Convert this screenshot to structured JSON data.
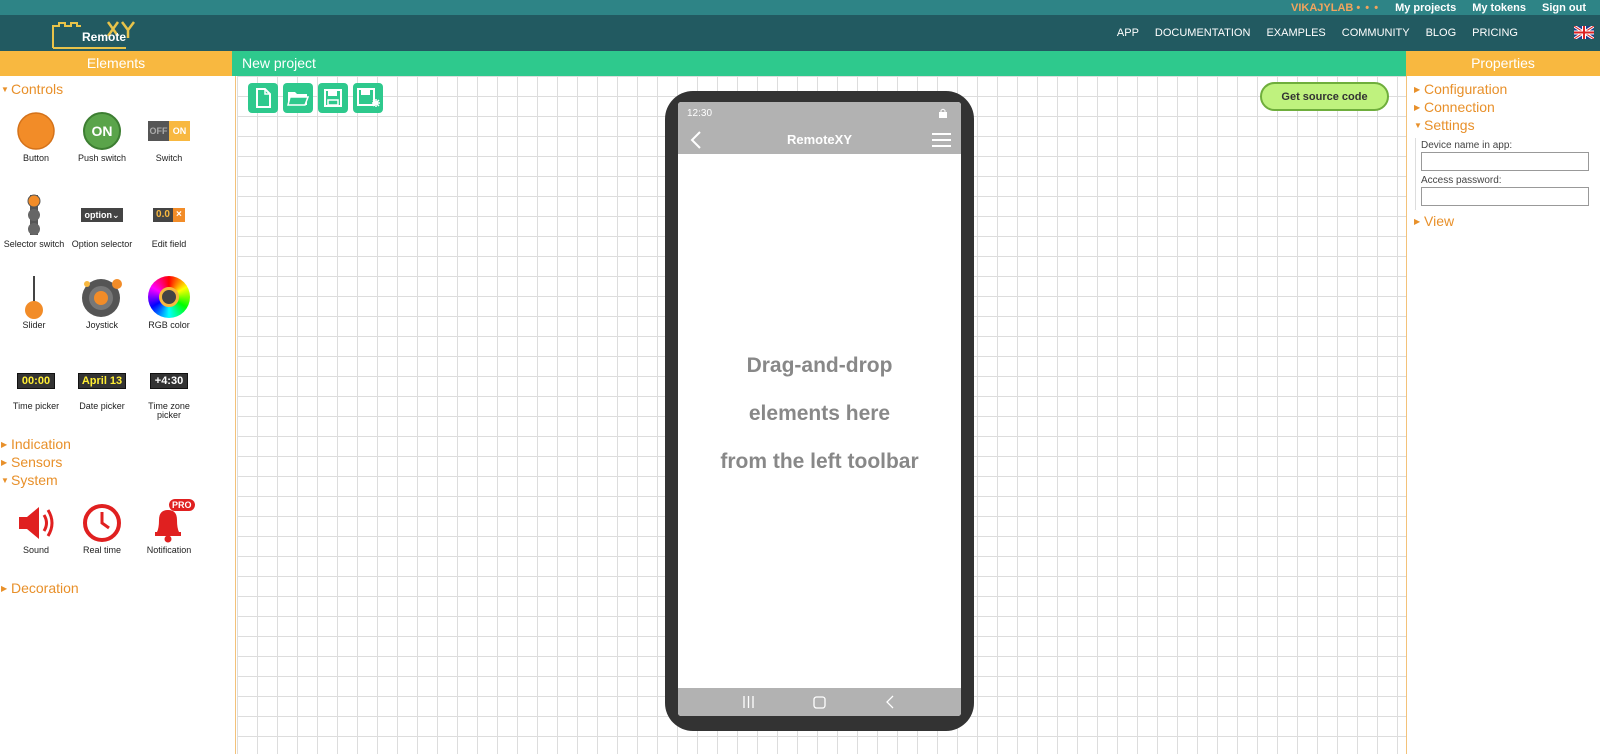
{
  "topbar": {
    "user": "VIKAJYLAB",
    "user_dots": "• • •",
    "links": [
      "My projects",
      "My tokens",
      "Sign out"
    ]
  },
  "navbar": {
    "logo_text": "Remote",
    "items": [
      "APP",
      "DOCUMENTATION",
      "EXAMPLES",
      "COMMUNITY",
      "BLOG",
      "PRICING"
    ]
  },
  "left_panel": {
    "header": "Elements",
    "sections": {
      "controls": "Controls",
      "indication": "Indication",
      "sensors": "Sensors",
      "system": "System",
      "decoration": "Decoration"
    },
    "controls": [
      {
        "label": "Button",
        "icon": "button-icon"
      },
      {
        "label": "Push switch",
        "icon": "push-switch-icon",
        "text": "ON"
      },
      {
        "label": "Switch",
        "icon": "switch-icon",
        "off": "OFF",
        "on": "ON"
      },
      {
        "label": "Selector switch",
        "icon": "selector-switch-icon"
      },
      {
        "label": "Option selector",
        "icon": "option-selector-icon",
        "text": "option"
      },
      {
        "label": "Edit field",
        "icon": "edit-field-icon",
        "text": "0.0"
      },
      {
        "label": "Slider",
        "icon": "slider-icon"
      },
      {
        "label": "Joystick",
        "icon": "joystick-icon"
      },
      {
        "label": "RGB color",
        "icon": "rgb-color-icon"
      },
      {
        "label": "Time picker",
        "icon": "time-picker-icon",
        "text": "00:00"
      },
      {
        "label": "Date picker",
        "icon": "date-picker-icon",
        "text": "April 13"
      },
      {
        "label": "Time zone picker",
        "icon": "time-zone-picker-icon",
        "text": "+4:30"
      }
    ],
    "system": [
      {
        "label": "Sound",
        "icon": "speaker-icon"
      },
      {
        "label": "Real time",
        "icon": "clock-icon"
      },
      {
        "label": "Notification",
        "icon": "bell-icon",
        "badge": "PRO"
      }
    ]
  },
  "project": {
    "title": "New project",
    "toolbar": [
      "new-file-icon",
      "open-folder-icon",
      "save-icon",
      "save-as-icon"
    ],
    "get_source_label": "Get source code",
    "phone": {
      "time": "12:30",
      "app_title": "RemoteXY",
      "drop_lines": [
        "Drag-and-drop",
        "elements here",
        "from the left toolbar"
      ]
    }
  },
  "right_panel": {
    "header": "Properties",
    "sections": {
      "configuration": "Configuration",
      "connection": "Connection",
      "settings": "Settings",
      "view": "View"
    },
    "device_name_label": "Device name in app:",
    "device_name_value": "",
    "password_label": "Access password:",
    "password_value": ""
  },
  "colors": {
    "accent_orange": "#f8b840",
    "accent_green": "#2ec98d",
    "nav_dark": "#225a61",
    "topbar": "#2e8486"
  }
}
